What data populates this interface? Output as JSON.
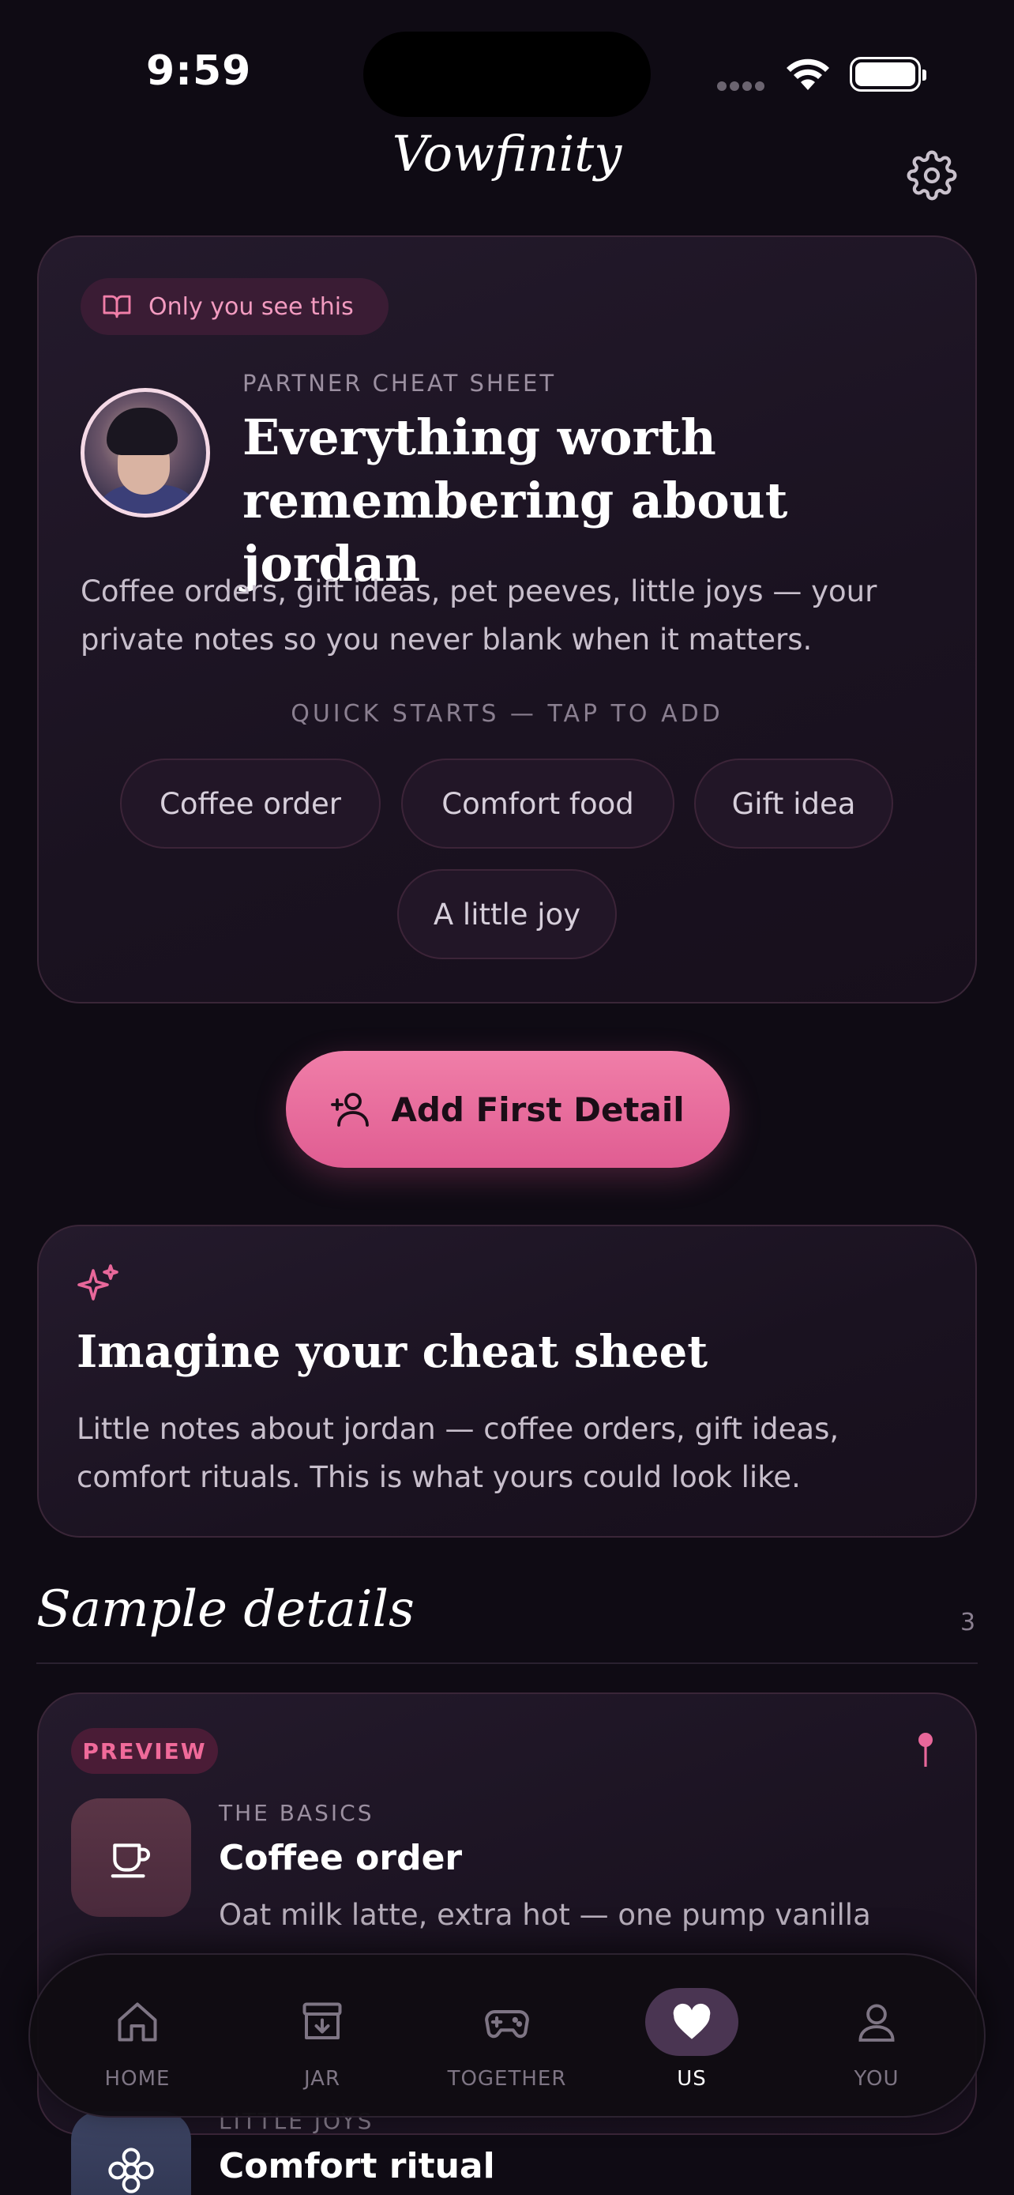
{
  "status_bar": {
    "time": "9:59"
  },
  "header": {
    "app_title": "Vowfinity"
  },
  "cheat_sheet": {
    "privacy_label": "Only you see this",
    "eyebrow": "PARTNER CHEAT SHEET",
    "heading": "Everything worth remembering about jordan",
    "intro": "Coffee orders, gift ideas, pet peeves, little joys — your private notes so you never blank when it matters.",
    "quick_starts_label": "QUICK STARTS — TAP TO ADD",
    "chips": [
      "Coffee order",
      "Comfort food",
      "Gift idea",
      "A little joy"
    ]
  },
  "cta": {
    "label": "Add First Detail"
  },
  "imagine": {
    "heading": "Imagine your cheat sheet",
    "text": "Little notes about jordan — coffee orders, gift ideas, comfort rituals. This is what yours could look like."
  },
  "sample": {
    "title": "Sample details",
    "count": "3",
    "items": [
      {
        "badge": "PREVIEW",
        "category": "THE BASICS",
        "title": "Coffee order",
        "description": "Oat milk latte, extra hot — one pump vanilla",
        "icon": "coffee-cup-icon"
      },
      {
        "category": "LITTLE JOYS",
        "title": "Comfort ritual",
        "icon": "flower-icon"
      }
    ]
  },
  "tabs": [
    {
      "label": "HOME",
      "icon": "home-icon"
    },
    {
      "label": "JAR",
      "icon": "jar-box-icon"
    },
    {
      "label": "TOGETHER",
      "icon": "gamepad-icon"
    },
    {
      "label": "US",
      "icon": "heart-icon",
      "active": true
    },
    {
      "label": "YOU",
      "icon": "person-icon"
    }
  ],
  "colors": {
    "accent_pink": "#e8679a",
    "background": "#0f0b14",
    "card": "#1e1524"
  }
}
